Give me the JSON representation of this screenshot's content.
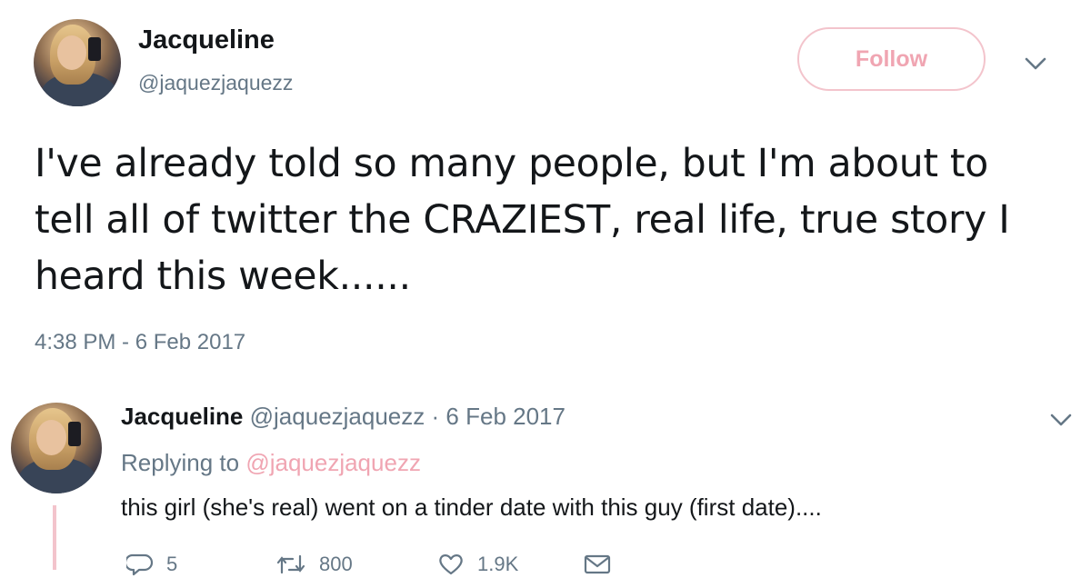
{
  "tweet": {
    "author": {
      "display_name": "Jacqueline",
      "handle": "@jaquezjaquezz"
    },
    "follow_label": "Follow",
    "text": "I've already told so many people, but I'm about to tell all of twitter the CRAZIEST, real life, true story I heard this week......",
    "timestamp": "4:38 PM - 6 Feb 2017",
    "more_icon": "chevron-down-icon"
  },
  "reply": {
    "author": {
      "display_name": "Jacqueline",
      "handle": "@jaquezjaquezz"
    },
    "date_separator": "·",
    "date": "6 Feb 2017",
    "replying_prefix": "Replying to",
    "replying_to": "@jaquezjaquezz",
    "text": "this girl (she's real) went on a tinder date with this guy (first date)....",
    "actions": {
      "reply_count": "5",
      "retweet_count": "800",
      "like_count": "1.9K"
    },
    "more_icon": "chevron-down-icon"
  },
  "colors": {
    "accent_pink": "#f0a5b2",
    "accent_pink_border": "#f3c4cc",
    "secondary_text": "#657786",
    "primary_text": "#14171a"
  }
}
